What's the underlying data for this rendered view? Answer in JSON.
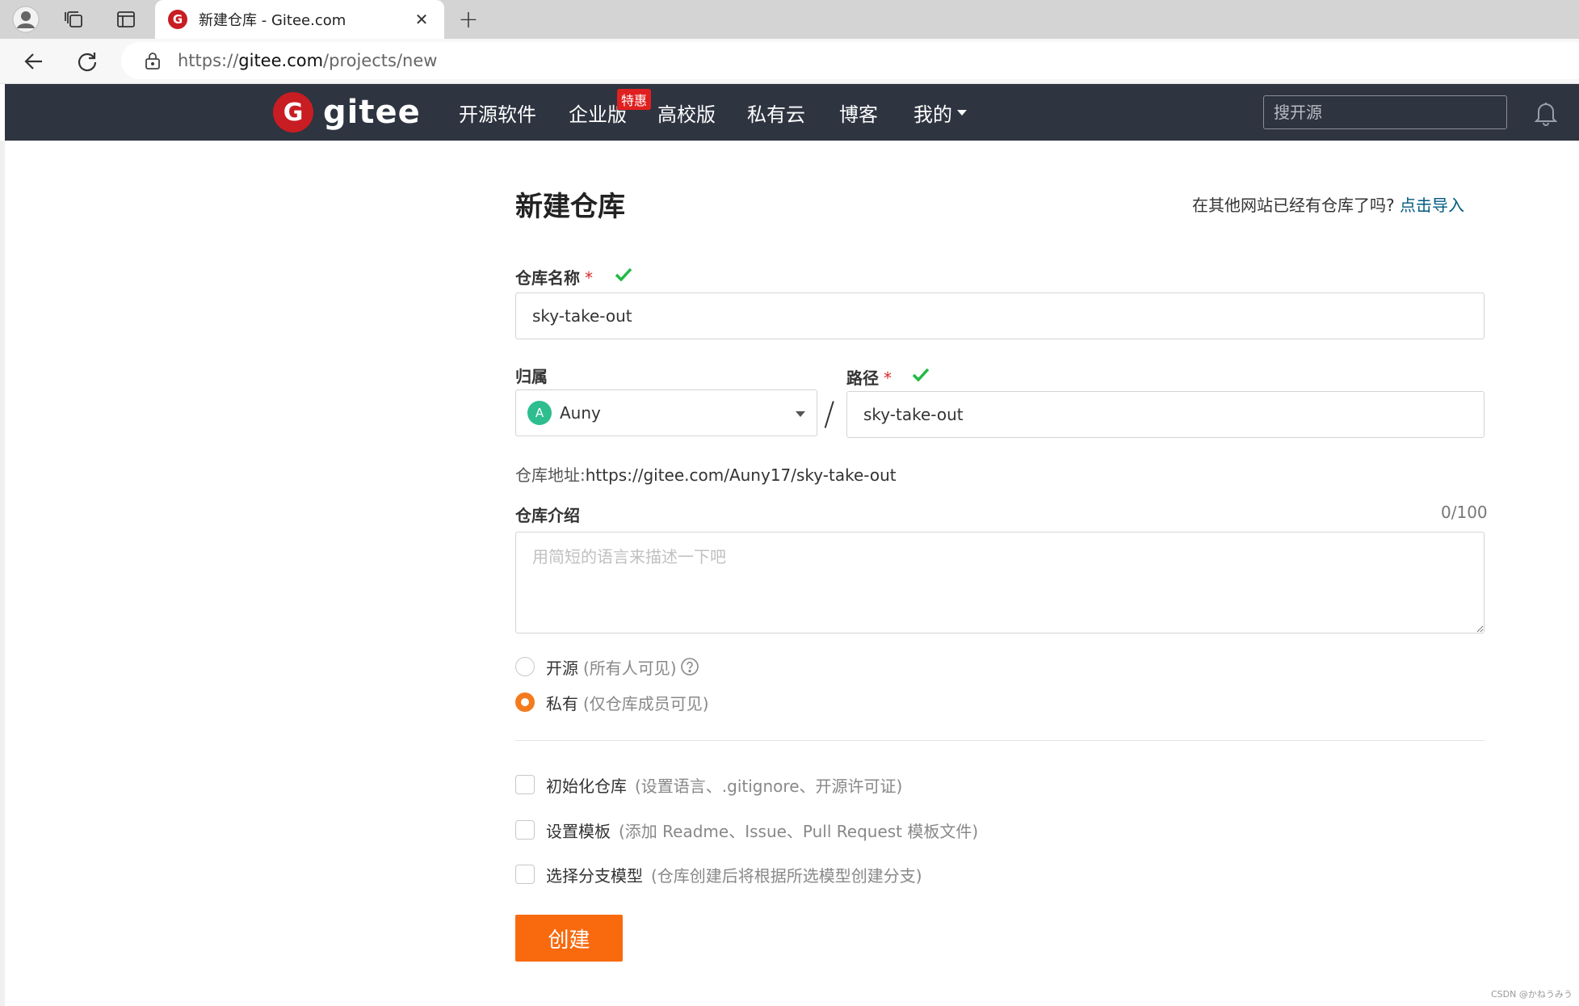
{
  "browser": {
    "tab_title": "新建仓库 - Gitee.com",
    "tab_close": "✕",
    "new_tab": "+",
    "url_scheme": "https://",
    "url_host": "gitee.com",
    "url_path": "/projects/new"
  },
  "header": {
    "logo_text": "gitee",
    "logo_mark": "G",
    "nav": [
      {
        "label": "开源软件"
      },
      {
        "label": "企业版"
      },
      {
        "label": "高校版"
      },
      {
        "label": "私有云"
      },
      {
        "label": "博客"
      },
      {
        "label": "我的"
      }
    ],
    "enterprise_badge": "特惠",
    "search_placeholder": "搜开源"
  },
  "form": {
    "title": "新建仓库",
    "import_prompt": "在其他网站已经有仓库了吗?",
    "import_link": "点击导入",
    "repo_name_label": "仓库名称",
    "required_mark": "*",
    "repo_name_value": "sky-take-out",
    "owner_label": "归属",
    "owner_avatar": "A",
    "owner_value": "Auny",
    "path_separator": "/",
    "path_label": "路径",
    "path_value": "sky-take-out",
    "repo_address_label": "仓库地址:",
    "repo_address_value": "https://gitee.com/Auny17/sky-take-out",
    "intro_label": "仓库介绍",
    "intro_counter": "0/100",
    "intro_placeholder": "用简短的语言来描述一下吧",
    "visibility": [
      {
        "label": "开源",
        "hint": "(所有人可见)",
        "checked": false
      },
      {
        "label": "私有",
        "hint": "(仅仓库成员可见)",
        "checked": true
      }
    ],
    "options": [
      {
        "label": "初始化仓库",
        "hint": "(设置语言、.gitignore、开源许可证)",
        "checked": false
      },
      {
        "label": "设置模板",
        "hint": "(添加 Readme、Issue、Pull Request 模板文件)",
        "checked": false
      },
      {
        "label": "选择分支模型",
        "hint": "(仓库创建后将根据所选模型创建分支)",
        "checked": false
      }
    ],
    "submit_label": "创建"
  },
  "watermark": "CSDN @かねうみう",
  "colors": {
    "header_bg": "#2e3440",
    "brand_red": "#c71d23",
    "accent_orange": "#f96a0f",
    "valid_green": "#21ba45",
    "link_blue": "#005980"
  }
}
